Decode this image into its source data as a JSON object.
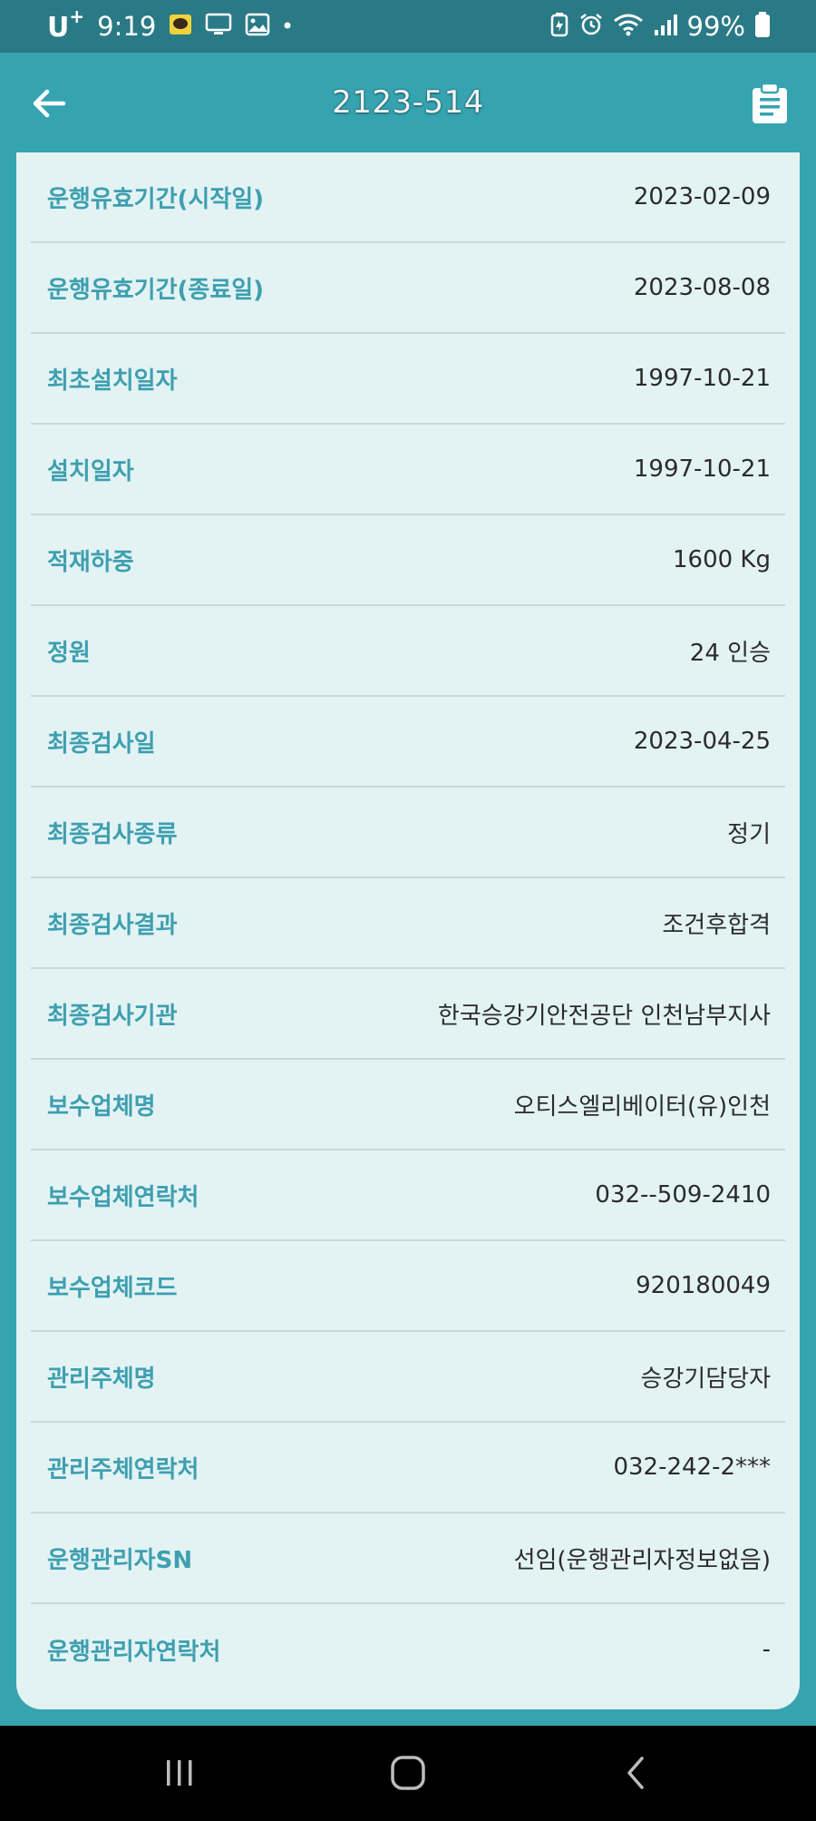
{
  "status_bar": {
    "carrier": "U",
    "carrier_sup": "+",
    "time": "9:19",
    "battery": "99%"
  },
  "header": {
    "title": "2123-514",
    "back_icon": "arrow-left-icon",
    "action_icon": "clipboard-icon"
  },
  "details": [
    {
      "label": "운행유효기간(시작일)",
      "value": "2023-02-09"
    },
    {
      "label": "운행유효기간(종료일)",
      "value": "2023-08-08"
    },
    {
      "label": "최초설치일자",
      "value": "1997-10-21"
    },
    {
      "label": "설치일자",
      "value": "1997-10-21"
    },
    {
      "label": "적재하중",
      "value": "1600 Kg"
    },
    {
      "label": "정원",
      "value": "24 인승"
    },
    {
      "label": "최종검사일",
      "value": "2023-04-25"
    },
    {
      "label": "최종검사종류",
      "value": "정기"
    },
    {
      "label": "최종검사결과",
      "value": "조건후합격"
    },
    {
      "label": "최종검사기관",
      "value": "한국승강기안전공단 인천남부지사"
    },
    {
      "label": "보수업체명",
      "value": "오티스엘리베이터(유)인천"
    },
    {
      "label": "보수업체연락처",
      "value": "032--509-2410"
    },
    {
      "label": "보수업체코드",
      "value": "920180049"
    },
    {
      "label": "관리주체명",
      "value": "승강기담당자"
    },
    {
      "label": "관리주체연락처",
      "value": "032-242-2***"
    },
    {
      "label": "운행관리자SN",
      "value": "선임(운행관리자정보없음)"
    },
    {
      "label": "운행관리자연락처",
      "value": "-"
    }
  ],
  "nav": {
    "recents_icon": "recent-apps-icon",
    "home_icon": "home-icon",
    "back_icon": "nav-back-icon"
  },
  "colors": {
    "status_bar": "#2a7a86",
    "app_bar": "#36a3b0",
    "card": "#e3f3f3",
    "label": "#3e9fb0",
    "value": "#2b2b2b"
  }
}
